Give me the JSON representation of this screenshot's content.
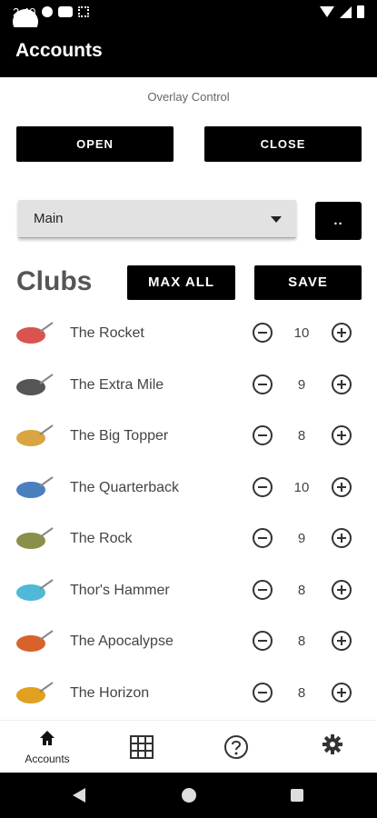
{
  "status_bar": {
    "time": "2:40"
  },
  "app_bar": {
    "title": "Accounts"
  },
  "overlay": {
    "label": "Overlay Control",
    "open_label": "OPEN",
    "close_label": "CLOSE"
  },
  "account_select": {
    "value": "Main",
    "more_label": ".."
  },
  "clubs": {
    "heading": "Clubs",
    "max_all_label": "MAX ALL",
    "save_label": "SAVE",
    "items": [
      {
        "name": "The Rocket",
        "count": "10",
        "color": "#d9534f"
      },
      {
        "name": "The Extra Mile",
        "count": "9",
        "color": "#555555"
      },
      {
        "name": "The Big Topper",
        "count": "8",
        "color": "#d9a441"
      },
      {
        "name": "The Quarterback",
        "count": "10",
        "color": "#4a7fbf"
      },
      {
        "name": "The Rock",
        "count": "9",
        "color": "#8a8f4a"
      },
      {
        "name": "Thor's Hammer",
        "count": "8",
        "color": "#4fb9d6"
      },
      {
        "name": "The Apocalypse",
        "count": "8",
        "color": "#d9622b"
      },
      {
        "name": "The Horizon",
        "count": "8",
        "color": "#e0a020"
      }
    ]
  },
  "bottom_nav": {
    "home_label": "Accounts",
    "icons": [
      "home-icon",
      "grid-icon",
      "help-icon",
      "settings-icon"
    ]
  }
}
